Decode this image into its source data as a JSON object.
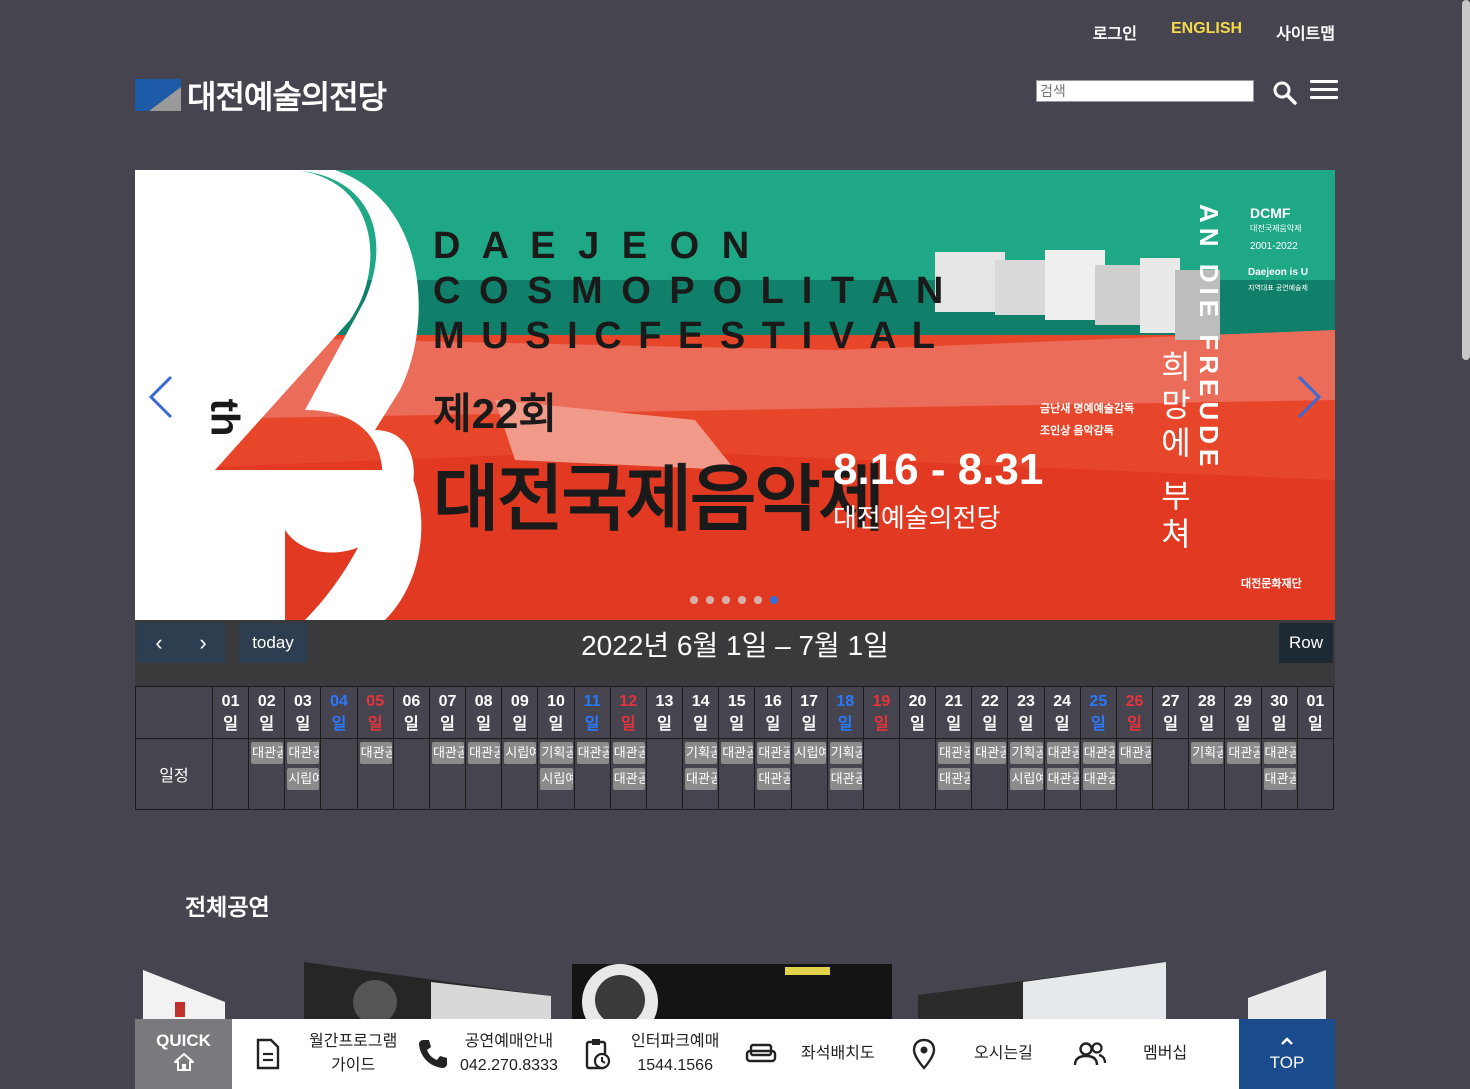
{
  "header": {
    "login": "로그인",
    "english": "ENGLISH",
    "sitemap": "사이트맵",
    "logo_text": "대전예술의전당",
    "search_placeholder": "검색"
  },
  "banner": {
    "line1": "D A E J E O N",
    "line2": "C O S M O P O L I T A N",
    "line3": "M U S I C  F E S T I V A L",
    "edition": "제22회",
    "title": "대전국제음악제",
    "dates": "8.16 - 8.31",
    "venue": "대전예술의전당",
    "directors1": "금난새 명예예술감독",
    "directors2": "조인상 음악감독",
    "vertical_kor": "희망에 부쳐",
    "vertical_eng": "AN DIE FREUDE",
    "dcmf": "DCMF",
    "dcmf_sub1": "대전국제음악제",
    "dcmf_sub2": "2001-2022",
    "dcmf_sub3": "Daejeon is U",
    "dcmf_sub4": "지역대표 공연예술제",
    "sponsor": "대전문화재단",
    "big_number": "22",
    "th": "th",
    "slide_count": 6,
    "active_slide": 6
  },
  "calendar": {
    "today_label": "today",
    "title": "2022년 6월 1일 – 7월 1일",
    "view_label": "Row",
    "row_label": "일정",
    "days": [
      {
        "d": "01",
        "c": ""
      },
      {
        "d": "02",
        "c": ""
      },
      {
        "d": "03",
        "c": ""
      },
      {
        "d": "04",
        "c": "blue"
      },
      {
        "d": "05",
        "c": "red"
      },
      {
        "d": "06",
        "c": ""
      },
      {
        "d": "07",
        "c": ""
      },
      {
        "d": "08",
        "c": ""
      },
      {
        "d": "09",
        "c": ""
      },
      {
        "d": "10",
        "c": ""
      },
      {
        "d": "11",
        "c": "blue"
      },
      {
        "d": "12",
        "c": "red"
      },
      {
        "d": "13",
        "c": ""
      },
      {
        "d": "14",
        "c": ""
      },
      {
        "d": "15",
        "c": ""
      },
      {
        "d": "16",
        "c": ""
      },
      {
        "d": "17",
        "c": ""
      },
      {
        "d": "18",
        "c": "blue"
      },
      {
        "d": "19",
        "c": "red"
      },
      {
        "d": "20",
        "c": ""
      },
      {
        "d": "21",
        "c": ""
      },
      {
        "d": "22",
        "c": ""
      },
      {
        "d": "23",
        "c": ""
      },
      {
        "d": "24",
        "c": ""
      },
      {
        "d": "25",
        "c": "blue"
      },
      {
        "d": "26",
        "c": "red"
      },
      {
        "d": "27",
        "c": ""
      },
      {
        "d": "28",
        "c": ""
      },
      {
        "d": "29",
        "c": ""
      },
      {
        "d": "30",
        "c": ""
      },
      {
        "d": "01",
        "c": ""
      }
    ],
    "day_suffix": "일",
    "events": [
      [],
      [
        "대관공연"
      ],
      [
        "대관공연",
        "시립예술단"
      ],
      [],
      [
        "대관공연"
      ],
      [],
      [
        "대관공연"
      ],
      [
        "대관공연"
      ],
      [
        "시립예술단"
      ],
      [
        "기획공연",
        "시립예술단"
      ],
      [
        "대관공연"
      ],
      [
        "대관공연",
        "대관공연"
      ],
      [],
      [
        "기획공연",
        "대관공연"
      ],
      [
        "대관공연"
      ],
      [
        "대관공연",
        "대관공연"
      ],
      [
        "시립예술단"
      ],
      [
        "기획공연",
        "대관공연"
      ],
      [],
      [],
      [
        "대관공연",
        "대관공연"
      ],
      [
        "대관공연"
      ],
      [
        "기획공연",
        "시립예술단"
      ],
      [
        "대관공연",
        "대관공연"
      ],
      [
        "대관공연",
        "대관공연"
      ],
      [
        "대관공연"
      ],
      [],
      [
        "기획공연"
      ],
      [
        "대관공연"
      ],
      [
        "대관공연",
        "대관공연"
      ],
      []
    ]
  },
  "section": {
    "title": "전체공연"
  },
  "quickbar": {
    "quick": "QUICK",
    "items": [
      {
        "l1": "월간프로그램",
        "l2": "가이드"
      },
      {
        "l1": "공연예매안내",
        "l2": "042.270.8333"
      },
      {
        "l1": "인터파크예매",
        "l2": "1544.1566"
      },
      {
        "l1": "좌석배치도",
        "l2": ""
      },
      {
        "l1": "오시는길",
        "l2": ""
      },
      {
        "l1": "멤버십",
        "l2": ""
      }
    ],
    "top": "TOP"
  },
  "colors": {
    "accent_blue": "#2b78ff",
    "holiday_red": "#e6333c",
    "english_yellow": "#f5d94a",
    "top_blue": "#1a4b8c"
  }
}
